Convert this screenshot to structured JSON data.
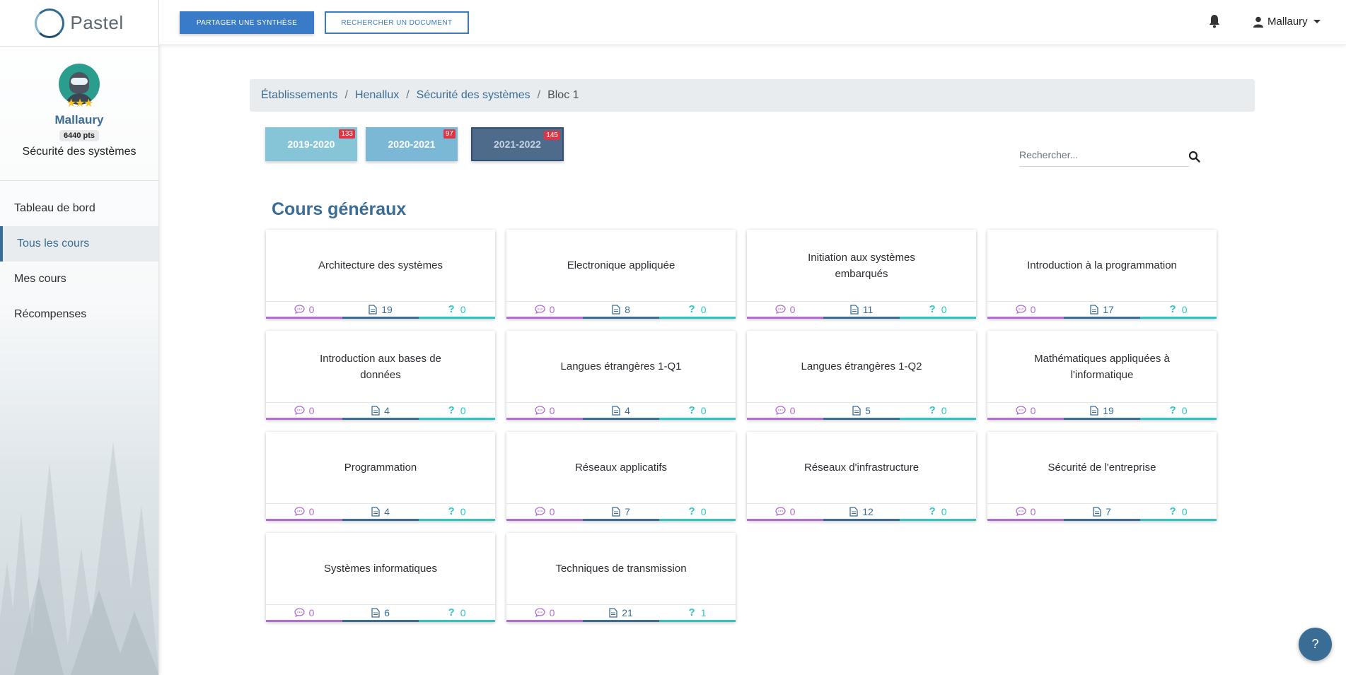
{
  "brand": {
    "name": "Pastel"
  },
  "profile": {
    "name": "Mallaury",
    "points": "6440 pts",
    "course": "Sécurité des systèmes"
  },
  "sidebar": {
    "items": [
      {
        "label": "Tableau de bord"
      },
      {
        "label": "Tous les cours"
      },
      {
        "label": "Mes cours"
      },
      {
        "label": "Récompenses"
      }
    ]
  },
  "topbar": {
    "share_label": "PARTAGER UNE SYNTHÈSE",
    "search_doc_label": "RECHERCHER UN DOCUMENT",
    "user_name": "Mallaury"
  },
  "breadcrumb": [
    "Établissements",
    "Henallux",
    "Sécurité des systèmes",
    "Bloc 1"
  ],
  "years": [
    {
      "label": "2019-2020",
      "count": "133"
    },
    {
      "label": "2020-2021",
      "count": "97"
    },
    {
      "label": "2021-2022",
      "count": "145"
    }
  ],
  "search": {
    "placeholder": "Rechercher..."
  },
  "section_title": "Cours généraux",
  "courses": [
    {
      "title": "Architecture des systèmes",
      "comments": "0",
      "docs": "19",
      "questions": "0"
    },
    {
      "title": "Electronique appliquée",
      "comments": "0",
      "docs": "8",
      "questions": "0"
    },
    {
      "title": "Initiation aux systèmes embarqués",
      "comments": "0",
      "docs": "11",
      "questions": "0"
    },
    {
      "title": "Introduction à la programmation",
      "comments": "0",
      "docs": "17",
      "questions": "0"
    },
    {
      "title": "Introduction aux bases de données",
      "comments": "0",
      "docs": "4",
      "questions": "0"
    },
    {
      "title": "Langues étrangères 1-Q1",
      "comments": "0",
      "docs": "4",
      "questions": "0"
    },
    {
      "title": "Langues étrangères 1-Q2",
      "comments": "0",
      "docs": "5",
      "questions": "0"
    },
    {
      "title": "Mathématiques appliquées à l'informatique",
      "comments": "0",
      "docs": "19",
      "questions": "0"
    },
    {
      "title": "Programmation",
      "comments": "0",
      "docs": "4",
      "questions": "0"
    },
    {
      "title": "Réseaux applicatifs",
      "comments": "0",
      "docs": "7",
      "questions": "0"
    },
    {
      "title": "Réseaux d'infrastructure",
      "comments": "0",
      "docs": "12",
      "questions": "0"
    },
    {
      "title": "Sécurité de l'entreprise",
      "comments": "0",
      "docs": "7",
      "questions": "0"
    },
    {
      "title": "Systèmes informatiques",
      "comments": "0",
      "docs": "6",
      "questions": "0"
    },
    {
      "title": "Techniques de transmission",
      "comments": "0",
      "docs": "21",
      "questions": "1"
    }
  ],
  "help": {
    "label": "?"
  },
  "colors": {
    "primary": "#3a6d96",
    "button": "#3a7bc8",
    "comments": "#b36bd6",
    "questions": "#2fc4c0",
    "badge": "#dc3545"
  }
}
